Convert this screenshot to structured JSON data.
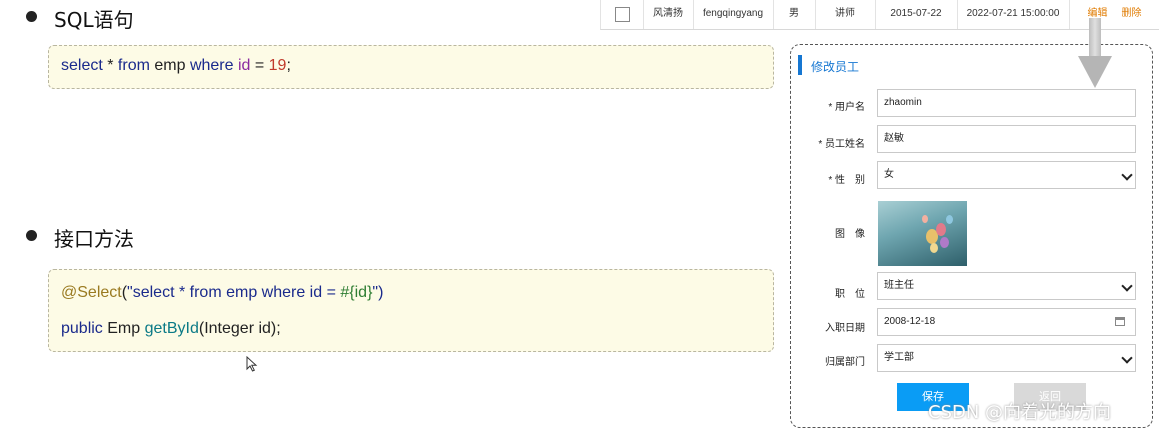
{
  "sections": {
    "sql_heading": "SQL语句",
    "sql_code": {
      "t1": "select",
      "t2": " * ",
      "t3": "from",
      "t4": " emp ",
      "t5": "where",
      "t6": " id",
      "t7": " = ",
      "t8": "19",
      "t9": ";"
    },
    "api_heading": "接口方法",
    "api_line1": {
      "a1": "@Select",
      "a2": "(",
      "a3": "\"select * from emp where id = ",
      "a4": "#{id}",
      "a5": "\")"
    },
    "api_line2": {
      "b1": "public",
      "b2": " Emp ",
      "b3": "getById",
      "b4": "(Integer id);"
    }
  },
  "table_row": {
    "name": "风清扬",
    "username": "fengqingyang",
    "gender": "男",
    "job": "讲师",
    "entry_date": "2015-07-22",
    "update_time": "2022-07-21 15:00:00",
    "edit_label": "编辑",
    "delete_label": "删除"
  },
  "form": {
    "title": "修改员工",
    "username_label": "* 用户名",
    "username_value": "zhaomin",
    "name_label": "* 员工姓名",
    "name_value": "赵敏",
    "gender_label": "* 性　别",
    "gender_value": "女",
    "image_label": "图　像",
    "job_label": "职　位",
    "job_value": "班主任",
    "entry_label": "入职日期",
    "entry_value": "2008-12-18",
    "dept_label": "归属部门",
    "dept_value": "学工部",
    "save_label": "保存",
    "back_label": "返回"
  },
  "watermark": "CSDN @向着光的方向",
  "colors": {
    "accent": "#1677d2",
    "save_button": "#0a9cf5",
    "link": "#e07b00",
    "code_bg": "#fdfbe6"
  }
}
